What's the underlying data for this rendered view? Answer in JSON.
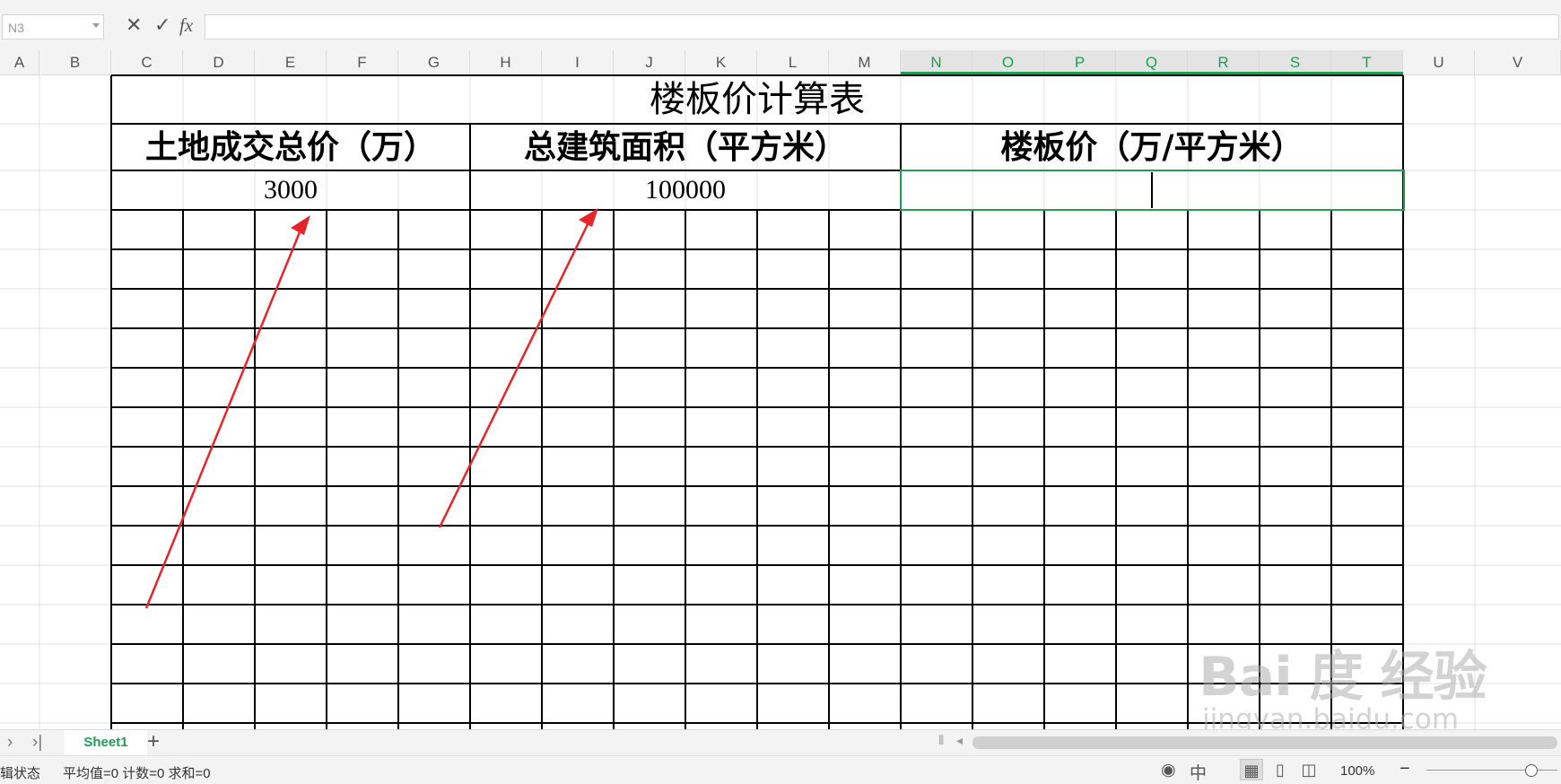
{
  "formula_bar": {
    "name_box": "N3",
    "cancel_icon": "✕",
    "confirm_icon": "✓",
    "fx_label": "fx",
    "formula_value": ""
  },
  "columns": [
    "A",
    "B",
    "C",
    "D",
    "E",
    "F",
    "G",
    "H",
    "I",
    "J",
    "K",
    "L",
    "M",
    "N",
    "O",
    "P",
    "Q",
    "R",
    "S",
    "T",
    "U",
    "V"
  ],
  "active_columns": [
    "N",
    "O",
    "P",
    "Q",
    "R",
    "S",
    "T"
  ],
  "sheet": {
    "title": "楼板价计算表",
    "header_land_price": "土地成交总价（万）",
    "header_floor_area": "总建筑面积（平方米）",
    "header_floor_price": "楼板价（万/平方米）",
    "value_land_price": "3000",
    "value_floor_area": "100000",
    "value_floor_price": ""
  },
  "tabs": {
    "nav_next": "›",
    "nav_last": "›|",
    "sheet_name": "Sheet1",
    "add": "+"
  },
  "status": {
    "mode": "辑状态",
    "stats": "平均值=0  计数=0  求和=0",
    "zoom": "100%",
    "zoom_level": 1.0
  },
  "watermark": {
    "logo": "Bai 度 经验",
    "url": "jingyan.baidu.com"
  },
  "colors": {
    "accent": "#1f9d55",
    "arrow": "#e8242a"
  },
  "icons": {
    "eye": "eye-icon",
    "input_method": "input-method-icon",
    "normal_view": "grid-view-icon",
    "page_layout": "page-layout-icon",
    "page_break": "page-break-icon"
  }
}
